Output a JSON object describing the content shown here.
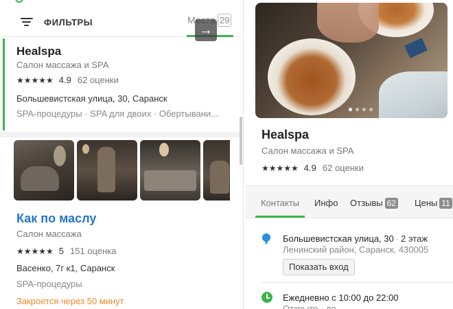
{
  "filters": {
    "label": "ФИЛЬТРЫ",
    "places_label": "Места",
    "places_count": "29"
  },
  "results": [
    {
      "title": "Healspa",
      "category": "Салон массажа и SPA",
      "stars": "★★★★★",
      "rating": "4.9",
      "reviews": "62 оценки",
      "address": "Большевистская улица, 30, Саранск",
      "tags": "SPA-процедуры · SPA для двоих · Обертывани..."
    },
    {
      "title": "Как по маслу",
      "category": "Салон массажа",
      "stars": "★★★★★",
      "rating": "5",
      "reviews": "151 оценка",
      "address": "Васенко, 7г к1, Саранск",
      "tags": "SPA-процедуры",
      "status": "Закроется через 50 минут"
    }
  ],
  "detail": {
    "title": "Healspa",
    "category": "Салон массажа и SPA",
    "stars": "★★★★★",
    "rating": "4.9",
    "reviews": "62 оценки",
    "tabs": [
      {
        "label": "Контакты"
      },
      {
        "label": "Инфо"
      },
      {
        "label": "Отзывы",
        "badge": "62"
      },
      {
        "label": "Цены",
        "badge": "11"
      }
    ],
    "address": {
      "street": "Большевистская улица, 30",
      "separator": "·",
      "floor": "2 этаж",
      "district": "Ленинский район, Саранск, 430005",
      "entrance_button": "Показать вход"
    },
    "hours": {
      "schedule": "Ежедневно с 10:00 до 22:00",
      "status": "Открыто · до"
    }
  },
  "icons": {
    "filter": "filter-icon",
    "next": "chevron-right-icon",
    "pin": "location-pin-icon",
    "clock": "clock-icon"
  },
  "colors": {
    "accent_green": "#3bb54a",
    "link_blue": "#2674c8",
    "warning_orange": "#f08a24",
    "pin_blue": "#2a8de0"
  }
}
